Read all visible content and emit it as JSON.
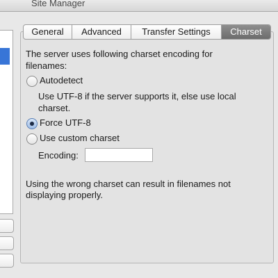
{
  "window": {
    "title": "Site Manager"
  },
  "tabs": [
    {
      "label": "General",
      "active": false
    },
    {
      "label": "Advanced",
      "active": false
    },
    {
      "label": "Transfer Settings",
      "active": false
    },
    {
      "label": "Charset",
      "active": true
    }
  ],
  "charset": {
    "intro_line1": "The server uses following charset encoding for",
    "intro_line2": "filenames:",
    "autodetect": {
      "label": "Autodetect",
      "checked": false,
      "desc_line1": "Use UTF-8 if the server supports it, else use local",
      "desc_line2": "charset."
    },
    "force_utf8": {
      "label": "Force UTF-8",
      "checked": true
    },
    "custom": {
      "label": "Use custom charset",
      "checked": false
    },
    "encoding_label": "Encoding:",
    "encoding_value": "",
    "warning_line1": "Using the wrong charset can result in filenames not",
    "warning_line2": "displaying properly."
  },
  "colors": {
    "selection": "#3875d7",
    "active_tab": "#7a7a7a"
  }
}
